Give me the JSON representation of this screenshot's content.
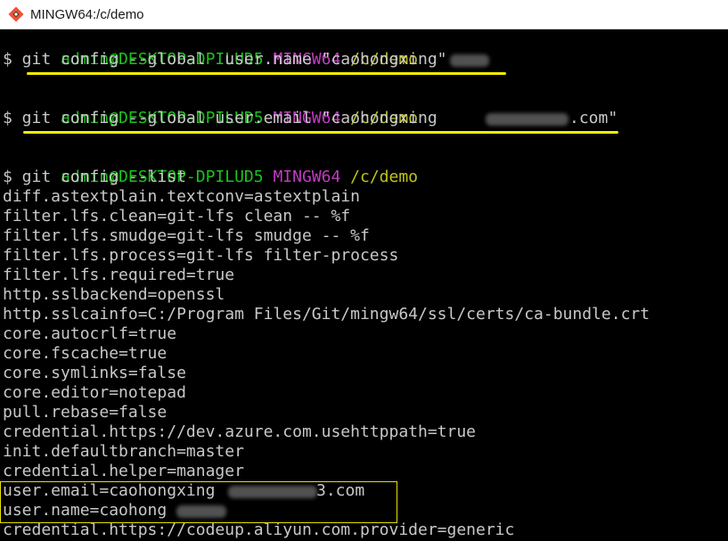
{
  "window": {
    "title": "MINGW64:/c/demo",
    "icon": "git-bash-icon"
  },
  "prompt": {
    "user_host": "admin@DESKTOP-DPILUD5",
    "shell": "MINGW64",
    "path": "/c/demo"
  },
  "commands": [
    "$ git config --global  user.name \"caohongxing\"",
    "$ git config --global user.email \"caohongxing",
    ".com\"",
    "$ git config --list"
  ],
  "output": [
    "diff.astextplain.textconv=astextplain",
    "filter.lfs.clean=git-lfs clean -- %f",
    "filter.lfs.smudge=git-lfs smudge -- %f",
    "filter.lfs.process=git-lfs filter-process",
    "filter.lfs.required=true",
    "http.sslbackend=openssl",
    "http.sslcainfo=C:/Program Files/Git/mingw64/ssl/certs/ca-bundle.crt",
    "core.autocrlf=true",
    "core.fscache=true",
    "core.symlinks=false",
    "core.editor=notepad",
    "pull.rebase=false",
    "credential.https://dev.azure.com.usehttppath=true",
    "init.defaultbranch=master",
    "credential.helper=manager",
    "user.email=caohongxing",
    "3.com",
    "user.name=caohong",
    "credential.https://codeup.aliyun.com.provider=generic"
  ],
  "colors": {
    "background": "#000000",
    "prompt_user": "#1cc21c",
    "prompt_shell": "#c23ac2",
    "prompt_path": "#c2c21c",
    "text": "#c8c8c8",
    "annotation": "#f5ee00"
  }
}
